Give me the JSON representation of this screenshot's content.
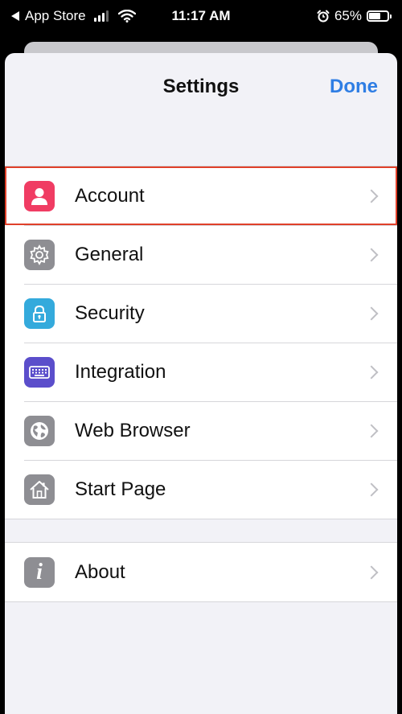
{
  "status_bar": {
    "back_app": "App Store",
    "time": "11:17 AM",
    "battery": "65%",
    "battery_level": 0.65
  },
  "header": {
    "title": "Settings",
    "done_label": "Done"
  },
  "colors": {
    "accent": "#2f7ee4",
    "highlight": "#e0402a",
    "account_icon": "#f03c63",
    "general_icon": "#8e8e93",
    "security_icon": "#34aadc",
    "integration_icon": "#5b4ecb",
    "web_browser_icon": "#8e8e93",
    "start_page_icon": "#8e8e93",
    "about_icon": "#8e8e93"
  },
  "settings": {
    "items": [
      {
        "label": "Account",
        "icon": "person-icon"
      },
      {
        "label": "General",
        "icon": "gear-icon"
      },
      {
        "label": "Security",
        "icon": "lock-icon"
      },
      {
        "label": "Integration",
        "icon": "keyboard-icon"
      },
      {
        "label": "Web Browser",
        "icon": "globe-icon"
      },
      {
        "label": "Start Page",
        "icon": "home-icon"
      }
    ],
    "about": {
      "label": "About",
      "icon": "info-icon"
    }
  }
}
